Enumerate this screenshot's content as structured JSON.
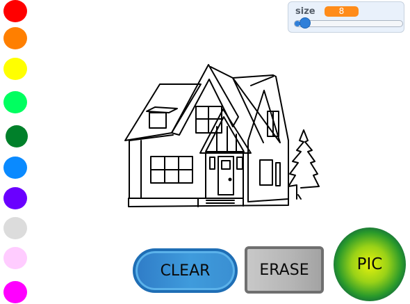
{
  "palette": [
    {
      "name": "red",
      "color": "#ff0000"
    },
    {
      "name": "orange",
      "color": "#ff7f00"
    },
    {
      "name": "yellow",
      "color": "#ffff00"
    },
    {
      "name": "light-green",
      "color": "#00ff60"
    },
    {
      "name": "dark-green",
      "color": "#00802a"
    },
    {
      "name": "blue",
      "color": "#0a8aff"
    },
    {
      "name": "violet",
      "color": "#6a00ff"
    },
    {
      "name": "light-gray",
      "color": "#dcdcdc"
    },
    {
      "name": "pink",
      "color": "#ffccff"
    },
    {
      "name": "magenta",
      "color": "#ff00ff"
    }
  ],
  "size_control": {
    "label": "size",
    "value": "8",
    "slider_level_percent": 5
  },
  "buttons": {
    "clear": "CLEAR",
    "erase": "ERASE",
    "pic": "PIC"
  },
  "colors": {
    "clear_button": "#3a8fd2",
    "erase_button": "#b5b5b5",
    "pic_button": "#2a9a2a",
    "size_value_bg": "#ff8c1a",
    "slider": "#2f7fd9"
  }
}
